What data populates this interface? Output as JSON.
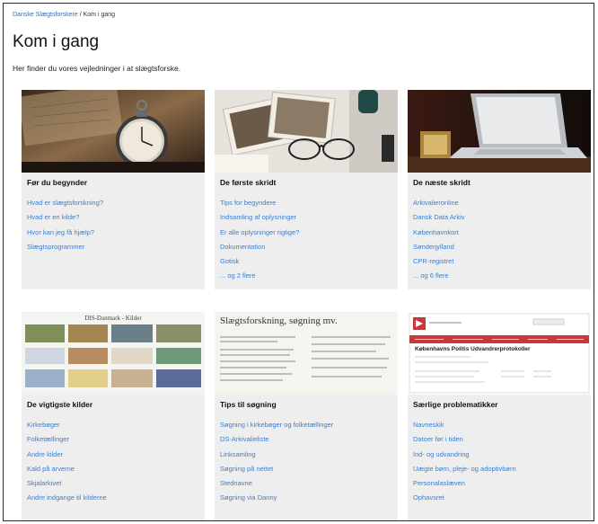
{
  "breadcrumb": {
    "home": "Danske Slægtsforskere",
    "separator": " / ",
    "current": "Kom i gang"
  },
  "page": {
    "title": "Kom i gang",
    "intro": "Her finder du vores vejledninger i at slægtsforske."
  },
  "cards": [
    {
      "title": "Før du begynder",
      "image_icon": "pocket-watch-photo",
      "links": [
        "Hvad er slægtsforskning?",
        "Hvad er en kilde?",
        "Hvor kan jeg få hjælp?",
        "Slægtsprogrammer"
      ]
    },
    {
      "title": "De første skridt",
      "image_icon": "old-photos-glasses-photo",
      "links": [
        "Tips for begyndere",
        "Indsamling af oplysninger",
        "Er alle oplysninger rigtige?",
        "Dokumentation",
        "Gotisk",
        "... og 2 flere"
      ]
    },
    {
      "title": "De næste skridt",
      "image_icon": "laptop-photo",
      "links": [
        "Arkivalieronline",
        "Dansk Data Arkiv",
        "Københavnkort",
        "Sønderjylland",
        "CPR-registret",
        "... og 6 flere"
      ]
    },
    {
      "title": "De vigtigste kilder",
      "image_icon": "dis-danmark-kilder-screenshot",
      "image_caption": "DIS-Danmark - Kilder",
      "links": [
        "Kirkebøger",
        "Folketællinger",
        "Andre kilder",
        "Kald på arverne",
        "Skjalarkivet",
        "Andre indgange til kilderne"
      ]
    },
    {
      "title": "Tips til søgning",
      "image_icon": "slaegtsforskning-sogning-screenshot",
      "image_caption": "Slægtsforskning, søgning mv.",
      "links": [
        "Søgning i kirkebøger og folketællinger",
        "DS-Arkivalieliste",
        "Linksamling",
        "Søgning på nettet",
        "Stednavne",
        "Søgning via Danny"
      ]
    },
    {
      "title": "Særlige problematikker",
      "image_icon": "politi-udvandrerprotokoller-screenshot",
      "image_caption": "Københavns Politis Udvandrerprotokoller",
      "links": [
        "Navneskik",
        "Datoer før i tiden",
        "Ind- og udvandring",
        "Uægte børn, pleje- og adoptivbørn",
        "Personalaslæven",
        "Ophavsret"
      ]
    }
  ],
  "colors": {
    "link": "#3a7fd0",
    "card_bg": "#eeeeee",
    "accent_red": "#c83a3a"
  }
}
